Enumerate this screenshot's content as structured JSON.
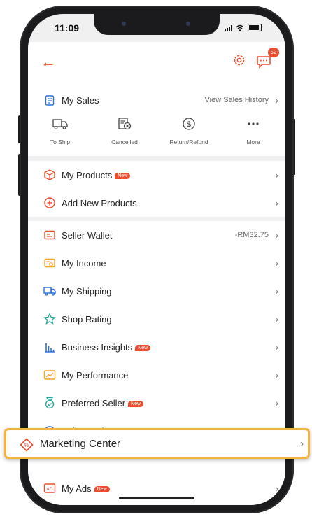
{
  "status": {
    "time": "11:09"
  },
  "header": {
    "chat_badge": "52"
  },
  "sales": {
    "title": "My Sales",
    "history_link": "View Sales History",
    "shortcuts": [
      {
        "label": "To Ship",
        "icon": "truck-icon"
      },
      {
        "label": "Cancelled",
        "icon": "cancelled-icon"
      },
      {
        "label": "Return/Refund",
        "icon": "refund-icon"
      },
      {
        "label": "More",
        "icon": "more-icon"
      }
    ]
  },
  "products": [
    {
      "label": "My Products",
      "badge": "New"
    },
    {
      "label": "Add New Products"
    }
  ],
  "menu": [
    {
      "label": "Seller Wallet",
      "value": "-RM32.75"
    },
    {
      "label": "My Income"
    },
    {
      "label": "My Shipping"
    },
    {
      "label": "Shop Rating"
    },
    {
      "label": "Business Insights",
      "badge": "New"
    },
    {
      "label": "My Performance"
    },
    {
      "label": "Preferred Seller",
      "badge": "New"
    },
    {
      "label": "Seller Assistant"
    },
    {
      "label": "My Ads",
      "badge": "New"
    }
  ],
  "highlight": {
    "label": "Marketing Center"
  },
  "colors": {
    "accent": "#ee4d2d",
    "highlight_border": "#f2b43c"
  }
}
